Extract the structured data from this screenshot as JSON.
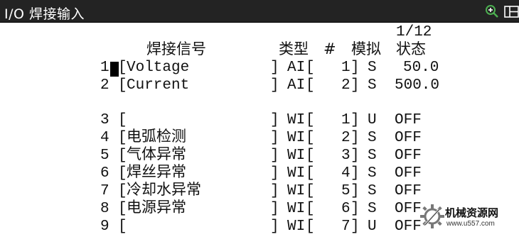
{
  "window": {
    "title": "I/O 焊接输入"
  },
  "toolbar": {
    "zoom_icon": "zoom-in-icon",
    "layout_icon": "split-layout-icon"
  },
  "page_indicator": "1/12",
  "headers": {
    "signal": "焊接信号",
    "type": "类型",
    "hash": "#",
    "sim": "模拟",
    "status": "状态"
  },
  "rows": [
    {
      "idx": "1",
      "name": "Voltage",
      "type": "AI",
      "num": "1",
      "sim": "S",
      "status": "50.0"
    },
    {
      "idx": "2",
      "name": "Current",
      "type": "AI",
      "num": "2",
      "sim": "S",
      "status": "500.0"
    },
    {
      "idx": "3",
      "name": "",
      "type": "WI",
      "num": "1",
      "sim": "U",
      "status": "OFF"
    },
    {
      "idx": "4",
      "name": "电弧检测",
      "type": "WI",
      "num": "2",
      "sim": "S",
      "status": "OFF"
    },
    {
      "idx": "5",
      "name": "气体异常",
      "type": "WI",
      "num": "3",
      "sim": "S",
      "status": "OFF"
    },
    {
      "idx": "6",
      "name": "焊丝异常",
      "type": "WI",
      "num": "4",
      "sim": "S",
      "status": "OFF"
    },
    {
      "idx": "7",
      "name": "冷却水异常",
      "type": "WI",
      "num": "5",
      "sim": "S",
      "status": "OFF"
    },
    {
      "idx": "8",
      "name": "电源异常",
      "type": "WI",
      "num": "6",
      "sim": "S",
      "status": "OFF"
    },
    {
      "idx": "9",
      "name": "",
      "type": "WI",
      "num": "7",
      "sim": "U",
      "status": "OFF"
    }
  ],
  "watermark": {
    "name": "机械资源网",
    "url": "www.u557.com"
  }
}
